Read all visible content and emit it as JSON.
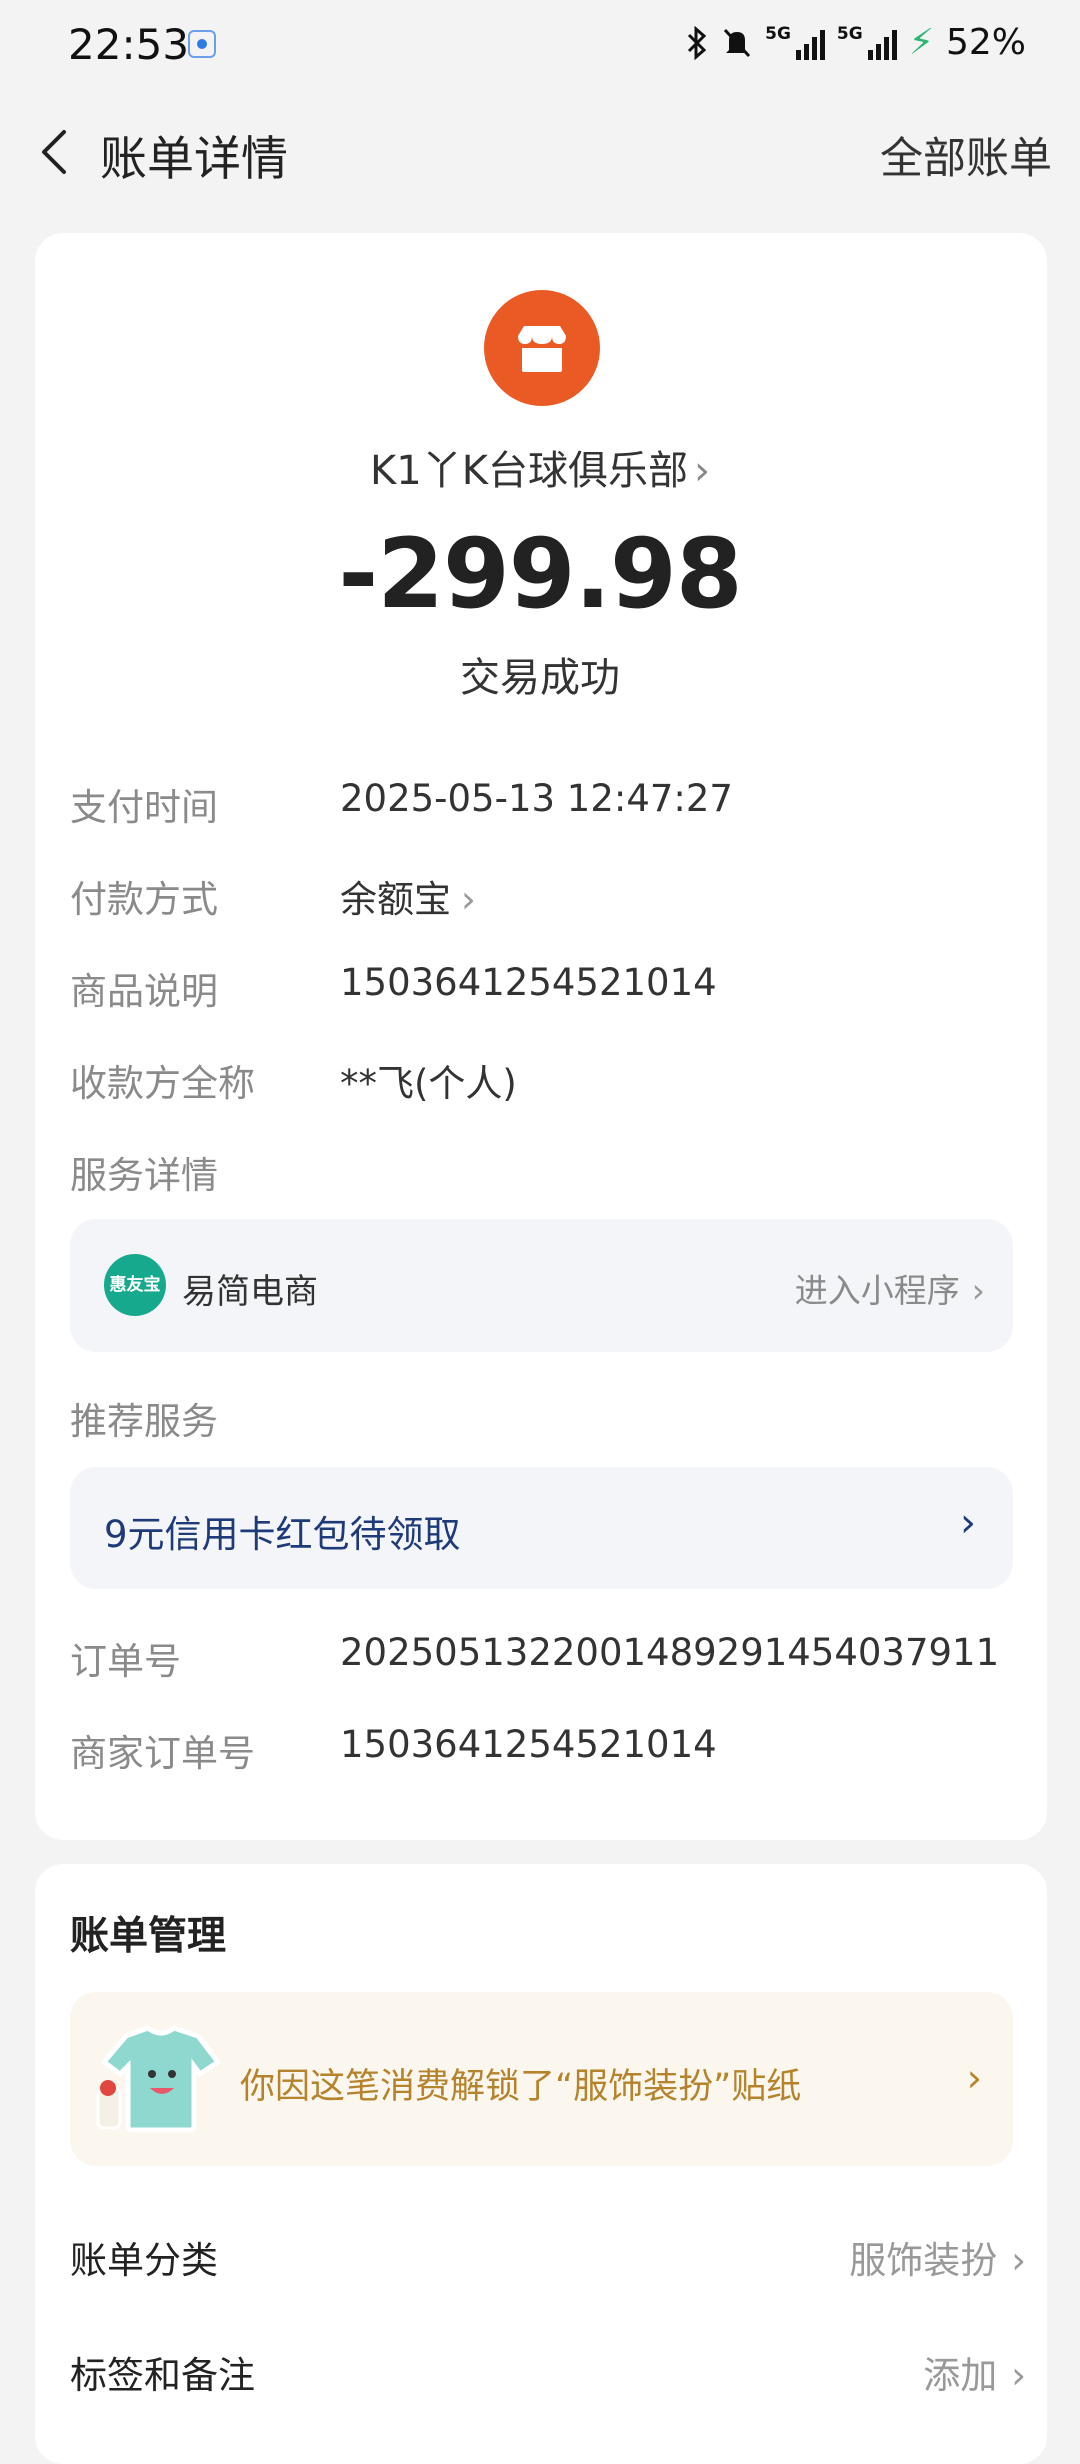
{
  "status_bar": {
    "time": "22:53",
    "network": "5G",
    "battery": "52%"
  },
  "nav": {
    "title": "账单详情",
    "all_bills": "全部账单"
  },
  "merchant": {
    "name": "K1丫K台球俱乐部",
    "amount": "-299.98",
    "status": "交易成功"
  },
  "details": [
    {
      "label": "支付时间",
      "value": "2025-05-13 12:47:27"
    },
    {
      "label": "付款方式",
      "value": "余额宝"
    },
    {
      "label": "商品说明",
      "value": "1503641254521014"
    },
    {
      "label": "收款方全称",
      "value": "**飞(个人)"
    }
  ],
  "service": {
    "section_label": "服务详情",
    "logo_text": "惠友宝",
    "name": "易简电商",
    "enter": "进入小程序"
  },
  "recommend": {
    "section_label": "推荐服务",
    "text": "9元信用卡红包待领取"
  },
  "orders": [
    {
      "label": "订单号",
      "value": "2025051322001489291454037911"
    },
    {
      "label": "商家订单号",
      "value": "1503641254521014"
    }
  ],
  "management": {
    "title": "账单管理",
    "sticker_text": "你因这笔消费解锁了“服饰装扮”贴纸",
    "category_label": "账单分类",
    "category_value": "服饰装扮",
    "tags_label": "标签和备注",
    "tags_value": "添加"
  },
  "colors": {
    "merchant_icon": "#ea5a25",
    "service_logo": "#17a98d",
    "recommend_text": "#1e3a78",
    "sticker_text": "#b5832b"
  },
  "icons": [
    "back-arrow-icon",
    "store-icon",
    "chevron-right-icon",
    "bluetooth-icon",
    "mute-icon",
    "signal-icon",
    "charging-icon",
    "tshirt-sticker-icon"
  ]
}
